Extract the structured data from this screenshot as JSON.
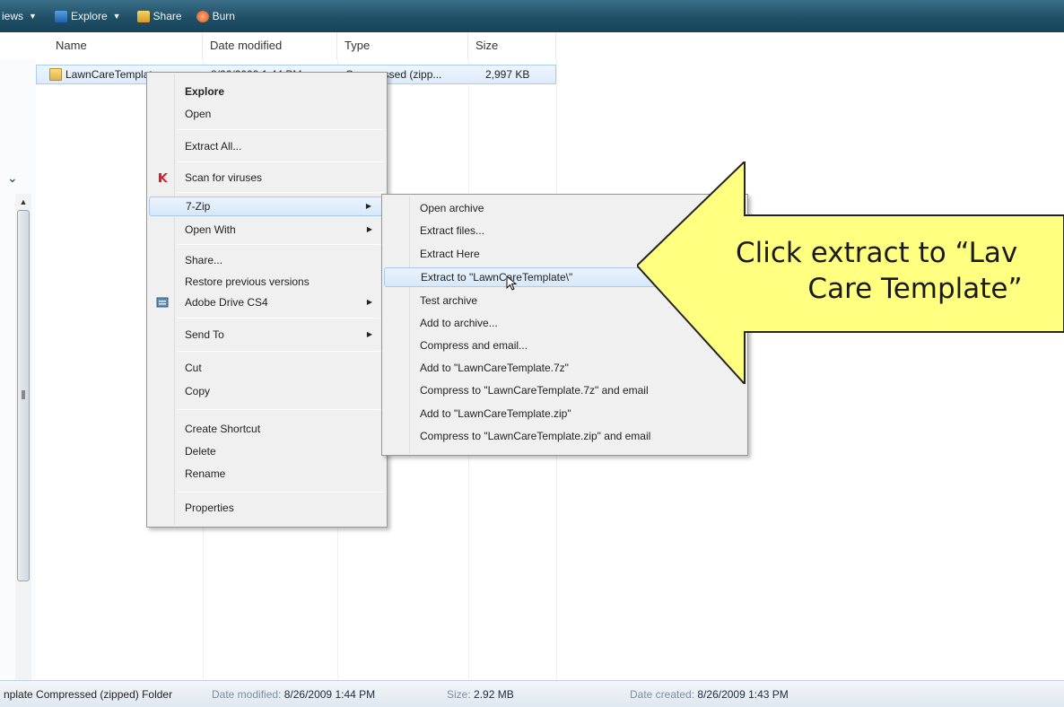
{
  "toolbar": {
    "items": [
      {
        "label": "iews",
        "has_dropdown": true
      },
      {
        "label": "Explore",
        "icon": "explore-icon",
        "has_dropdown": true
      },
      {
        "label": "Share",
        "icon": "share-icon"
      },
      {
        "label": "Burn",
        "icon": "burn-icon"
      }
    ]
  },
  "columns": {
    "name": "Name",
    "date_modified": "Date modified",
    "type": "Type",
    "size": "Size"
  },
  "file": {
    "name": "LawnCareTemplate",
    "date_modified": "8/26/2009 1:44 PM",
    "type": "Compressed (zipp...",
    "size": "2,997 KB",
    "icon": "zip-folder-icon"
  },
  "context_menu": {
    "items": [
      {
        "label": "Explore",
        "bold": true
      },
      {
        "label": "Open"
      },
      {
        "label": "Extract All..."
      },
      {
        "label": "Scan for viruses",
        "icon": "kaspersky-icon"
      },
      {
        "label": "7-Zip",
        "submenu": true,
        "active": true
      },
      {
        "label": "Open With",
        "submenu": true
      },
      {
        "label": "Share..."
      },
      {
        "label": "Restore previous versions"
      },
      {
        "label": "Adobe Drive CS4",
        "submenu": true,
        "icon": "adobe-drive-icon"
      },
      {
        "label": "Send To",
        "submenu": true
      },
      {
        "label": "Cut"
      },
      {
        "label": "Copy"
      },
      {
        "label": "Create Shortcut"
      },
      {
        "label": "Delete"
      },
      {
        "label": "Rename"
      },
      {
        "label": "Properties"
      }
    ]
  },
  "submenu": {
    "items": [
      {
        "label": "Open archive"
      },
      {
        "label": "Extract files..."
      },
      {
        "label": "Extract Here"
      },
      {
        "label": "Extract to \"LawnCareTemplate\\\"",
        "active": true
      },
      {
        "label": "Test archive"
      },
      {
        "label": "Add to archive..."
      },
      {
        "label": "Compress and email..."
      },
      {
        "label": "Add to \"LawnCareTemplate.7z\""
      },
      {
        "label": "Compress to \"LawnCareTemplate.7z\" and email"
      },
      {
        "label": "Add to \"LawnCareTemplate.zip\""
      },
      {
        "label": "Compress to \"LawnCareTemplate.zip\" and email"
      }
    ]
  },
  "callout": {
    "line1": "Click extract to “Lav",
    "line2": "Care Template”",
    "fill": "#ffff80",
    "stroke": "#222222"
  },
  "statusbar": {
    "name": "nplate Compressed (zipped) Folder",
    "date_modified_label": "Date modified:",
    "date_modified": "8/26/2009 1:44 PM",
    "size_label": "Size:",
    "size": "2.92 MB",
    "date_created_label": "Date created:",
    "date_created": "8/26/2009 1:43 PM"
  }
}
